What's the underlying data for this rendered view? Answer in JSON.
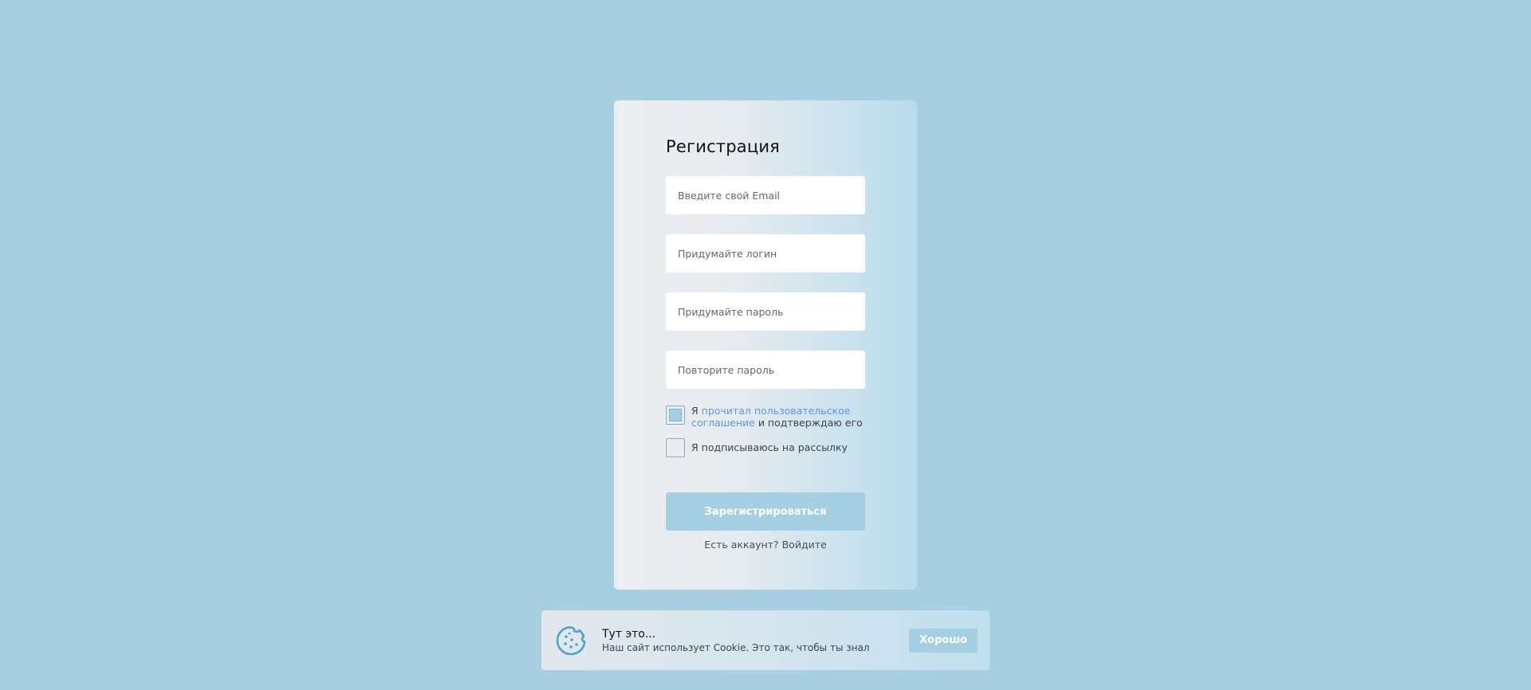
{
  "registration": {
    "title": "Регистрация",
    "email_placeholder": "Введите свой Email",
    "login_placeholder": "Придумайте логин",
    "password_placeholder": "Придумайте пароль",
    "repeat_password_placeholder": "Повторите пароль",
    "agreement": {
      "prefix": "Я ",
      "link": "прочитал пользовательское соглашение",
      "suffix": " и подтверждаю его",
      "checked": true
    },
    "newsletter": {
      "label": "Я подписываюсь на рассылку",
      "checked": false
    },
    "submit_label": "Зарегистрироваться",
    "has_account_text": "Есть аккаунт?",
    "login_link": "Войдите"
  },
  "cookie_banner": {
    "title": "Тут это...",
    "text": "Наш сайт использует Cookie. Это так, чтобы ты знал",
    "accept_label": "Хорошо",
    "icon": "cookie-icon"
  },
  "colors": {
    "background": "#a8cfe1",
    "accent": "#a5cfe2",
    "link": "#5f95e8"
  }
}
